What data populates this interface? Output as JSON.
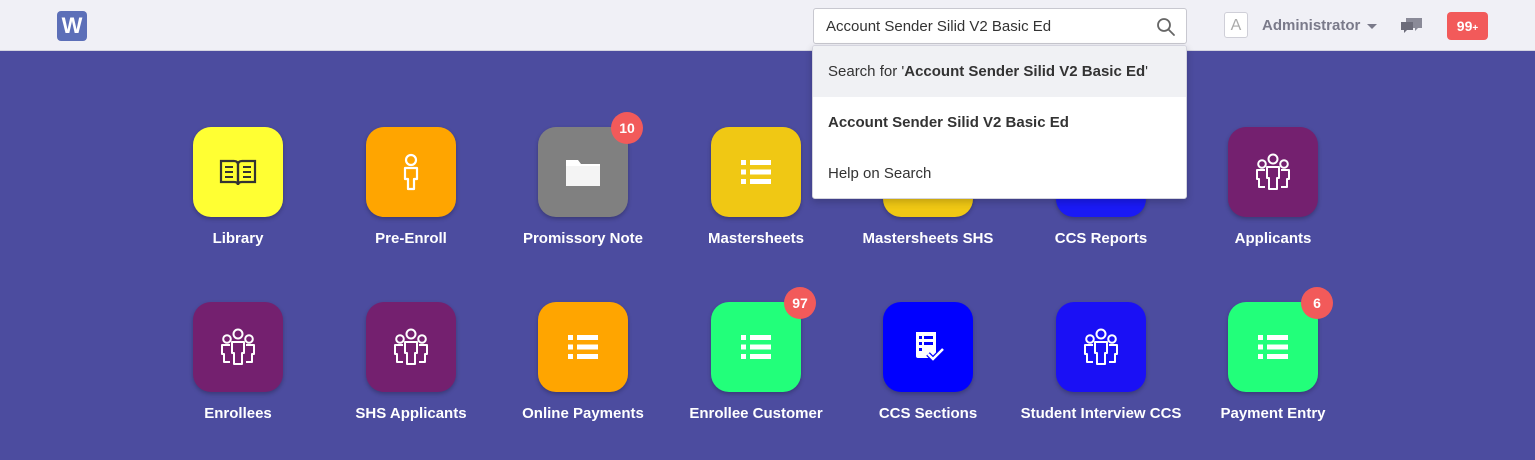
{
  "navbar": {
    "logo_letter": "W",
    "search_value": "Account Sender Silid V2 Basic Ed",
    "avatar_letter": "A",
    "user_name": "Administrator",
    "notifications": {
      "count": "99",
      "suffix": "+"
    }
  },
  "search_dropdown": {
    "search_for_prefix": "Search for '",
    "search_for_term": "Account Sender Silid V2 Basic Ed",
    "search_for_suffix": "'",
    "result": "Account Sender Silid V2 Basic Ed",
    "help": "Help on Search"
  },
  "row1": [
    {
      "label": "Library",
      "color": "#ffff33",
      "icon": "book-icon",
      "badge": ""
    },
    {
      "label": "Pre-Enroll",
      "color": "#ffa500",
      "icon": "person-icon",
      "badge": ""
    },
    {
      "label": "Promissory Note",
      "color": "#808080",
      "icon": "folder-icon",
      "badge": "10"
    },
    {
      "label": "Mastersheets",
      "color": "#f0c814",
      "icon": "list-icon",
      "badge": ""
    },
    {
      "label": "Mastersheets SHS",
      "color": "#f0c814",
      "icon": "list-icon",
      "badge": ""
    },
    {
      "label": "CCS Reports",
      "color": "#1a1af5",
      "icon": "list-icon",
      "badge": ""
    },
    {
      "label": "Applicants",
      "color": "#74206f",
      "icon": "users-icon",
      "badge": ""
    }
  ],
  "row2": [
    {
      "label": "Enrollees",
      "color": "#74206f",
      "icon": "users-icon",
      "badge": ""
    },
    {
      "label": "SHS Applicants",
      "color": "#74206f",
      "icon": "users-icon",
      "badge": ""
    },
    {
      "label": "Online Payments",
      "color": "#ffa500",
      "icon": "list-icon",
      "badge": ""
    },
    {
      "label": "Enrollee Customer",
      "color": "#22ff7a",
      "icon": "list-icon",
      "badge": "97"
    },
    {
      "label": "CCS Sections",
      "color": "#0000ff",
      "icon": "checklist-icon",
      "badge": ""
    },
    {
      "label": "Student Interview CCS",
      "color": "#1a10f5",
      "icon": "users-icon",
      "badge": ""
    },
    {
      "label": "Payment Entry",
      "color": "#22ff7a",
      "icon": "list-icon",
      "badge": "6"
    }
  ],
  "colors": {
    "background": "#4c4c9f",
    "navbar": "#f0f0f6",
    "badge": "#f25a5a"
  }
}
